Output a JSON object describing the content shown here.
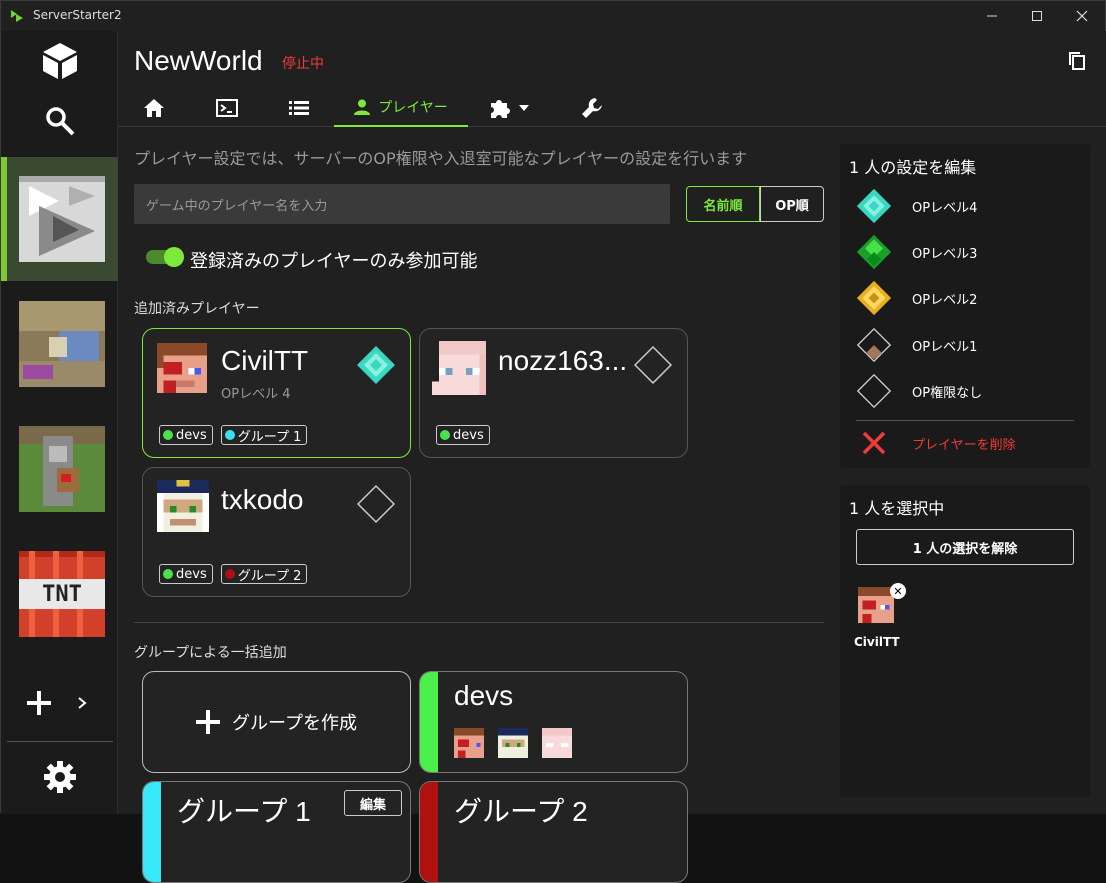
{
  "window": {
    "title": "ServerStarter2",
    "minimize": "—",
    "maximize": "☐",
    "close": "✕"
  },
  "header": {
    "world_name": "NewWorld",
    "status": "停止中"
  },
  "tabs": [
    {
      "icon": "home-icon"
    },
    {
      "icon": "console-icon"
    },
    {
      "icon": "list-icon"
    },
    {
      "icon": "person-icon",
      "label": "プレイヤー",
      "active": true
    },
    {
      "icon": "puzzle-icon"
    },
    {
      "icon": "wrench-icon"
    }
  ],
  "main": {
    "description": "プレイヤー設定では、サーバーのOP権限や入退室可能なプレイヤーの設定を行います",
    "search_placeholder": "ゲーム中のプレイヤー名を入力",
    "sort_name": "名前順",
    "sort_op": "OP順",
    "whitelist_label": "登録済みのプレイヤーのみ参加可能",
    "whitelist_on": true,
    "players_section": "追加済みプレイヤー",
    "groups_section": "グループによる一括追加",
    "create_group": "グループを作成",
    "edit_label": "編集"
  },
  "players": [
    {
      "name": "CivilTT",
      "level": "OPレベル 4",
      "tags": [
        {
          "name": "devs",
          "color": "#4ce04c"
        },
        {
          "name": "グループ 1",
          "color": "#39e0f0"
        }
      ],
      "selected": true
    },
    {
      "name": "nozz163...",
      "level": "",
      "tags": [
        {
          "name": "devs",
          "color": "#4ce04c"
        }
      ],
      "selected": false
    },
    {
      "name": "txkodo",
      "level": "",
      "tags": [
        {
          "name": "devs",
          "color": "#4ce04c"
        },
        {
          "name": "グループ 2",
          "color": "#b01010"
        }
      ],
      "selected": false
    }
  ],
  "groups": [
    {
      "name": "devs",
      "color": "#4cf04c"
    },
    {
      "name": "グループ 1",
      "color": "#39e8f8"
    },
    {
      "name": "グループ 2",
      "color": "#b01010"
    }
  ],
  "edit_panel": {
    "title": "1 人の設定を編集",
    "op4": "OPレベル4",
    "op3": "OPレベル3",
    "op2": "OPレベル2",
    "op1": "OPレベル1",
    "op0": "OP権限なし",
    "delete": "プレイヤーを削除"
  },
  "select_panel": {
    "title": "1 人を選択中",
    "deselect": "1 人の選択を解除",
    "selected_name": "CivilTT"
  },
  "colors": {
    "accent": "#7de93a",
    "danger": "#f23a3a"
  }
}
